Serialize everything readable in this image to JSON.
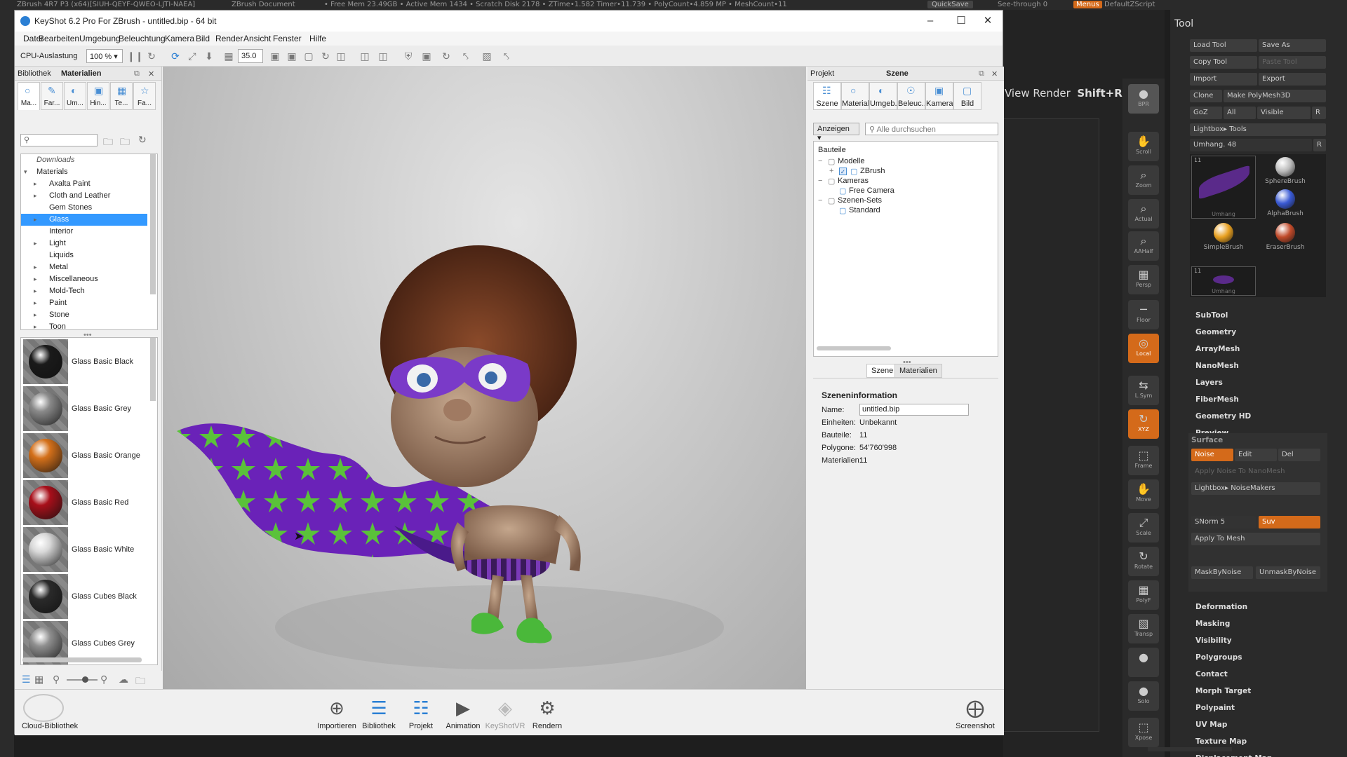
{
  "zbrush": {
    "top_left": "ZBrush 4R7 P3 (x64)[SIUH-QEYF-QWEO-LJTI-NAEA]",
    "doc": "ZBrush Document",
    "stats": "• Free Mem 23.49GB • Active Mem 1434 • Scratch Disk 2178 • ZTime•1.582 Timer•11.739 • PolyCount•4.859 MP • MeshCount•11",
    "quicksave": "QuickSave",
    "see_through": "See-through 0",
    "menus": "Menus",
    "script": "DefaultZScript",
    "view_render": "View Render",
    "view_render_shortcut": "Shift+R",
    "shelf": [
      {
        "name": "bpr",
        "label": "BPR",
        "glyph": "●",
        "or": false
      },
      {
        "name": "scroll",
        "label": "Scroll",
        "glyph": "✋",
        "or": false
      },
      {
        "name": "zoom",
        "label": "Zoom",
        "glyph": "⌕",
        "or": false
      },
      {
        "name": "actual",
        "label": "Actual",
        "glyph": "⌕",
        "or": false
      },
      {
        "name": "aahalf",
        "label": "AAHalf",
        "glyph": "⌕",
        "or": false
      },
      {
        "name": "persp",
        "label": "Persp",
        "glyph": "▦",
        "or": false
      },
      {
        "name": "floor",
        "label": "Floor",
        "glyph": "─",
        "or": false
      },
      {
        "name": "local",
        "label": "Local",
        "glyph": "◎",
        "or": true
      },
      {
        "name": "lsym",
        "label": "L.Sym",
        "glyph": "⇆",
        "or": false
      },
      {
        "name": "xyz",
        "label": "XYZ",
        "glyph": "↻",
        "or": true
      },
      {
        "name": "frame",
        "label": "Frame",
        "glyph": "⬚",
        "or": false
      },
      {
        "name": "move",
        "label": "Move",
        "glyph": "✋",
        "or": false
      },
      {
        "name": "scale",
        "label": "Scale",
        "glyph": "⤢",
        "or": false
      },
      {
        "name": "rotate",
        "label": "Rotate",
        "glyph": "↻",
        "or": false
      },
      {
        "name": "polyf",
        "label": "PolyF",
        "glyph": "▦",
        "or": false
      },
      {
        "name": "transp",
        "label": "Transp",
        "glyph": "▧",
        "or": false
      },
      {
        "name": "ghost",
        "label": "",
        "glyph": "●",
        "or": false
      },
      {
        "name": "solo",
        "label": "Solo",
        "glyph": "●",
        "or": false
      },
      {
        "name": "xpose",
        "label": "Xpose",
        "glyph": "⬚",
        "or": false
      }
    ],
    "tool": {
      "title": "Tool",
      "load_tool": "Load Tool",
      "save_as": "Save As",
      "copy_tool": "Copy Tool",
      "paste_tool": "Paste Tool",
      "import": "Import",
      "export": "Export",
      "clone": "Clone",
      "make_polymesh": "Make PolyMesh3D",
      "goz": "GoZ",
      "all": "All",
      "visible": "Visible",
      "r": "R",
      "lightbox_tools": "Lightbox▸ Tools",
      "umhang": "Umhang. 48",
      "brushes": [
        {
          "label": "Umhang",
          "color": "#5a2a8a"
        },
        {
          "label": "SphereBrush",
          "color": "#bbbbbb"
        },
        {
          "label": "AlphaBrush",
          "color": "#3a5ad4"
        },
        {
          "label": "SimpleBrush",
          "color": "#e8a020"
        },
        {
          "label": "EraserBrush",
          "color": "#c04a2a"
        },
        {
          "label": "Umhang",
          "color": "#5a2a8a"
        }
      ],
      "count_a": "11",
      "count_b": "11",
      "sections_a": [
        "SubTool",
        "Geometry",
        "ArrayMesh",
        "NanoMesh",
        "Layers",
        "FiberMesh",
        "Geometry HD",
        "Preview"
      ],
      "surface": "Surface",
      "noise": "Noise",
      "edit": "Edit",
      "del": "Del",
      "apply_noise": "Apply Noise To NanoMesh",
      "lightbox_noise": "Lightbox▸ NoiseMakers",
      "snorm": "SNorm 5",
      "suv": "Suv",
      "apply_mesh": "Apply To Mesh",
      "mask_by_noise": "MaskByNoise",
      "unmask_by_noise": "UnmaskByNoise",
      "sections_b": [
        "Deformation",
        "Masking",
        "Visibility",
        "Polygroups",
        "Contact",
        "Morph Target",
        "Polypaint",
        "UV Map",
        "Texture Map",
        "Displacement Map"
      ]
    }
  },
  "keyshot": {
    "title": "KeyShot 6.2 Pro For ZBrush - untitled.bip - 64 bit",
    "menu": [
      "Datei",
      "Bearbeiten",
      "Umgebung",
      "Beleuchtung",
      "Kamera",
      "Bild",
      "Render",
      "Ansicht",
      "Fenster",
      "Hilfe"
    ],
    "cpu_label": "CPU-Auslastung",
    "cpu_value": "100 %",
    "fov_value": "35.0",
    "library": {
      "tab_library": "Bibliothek",
      "tab_materials": "Materialien",
      "type_tabs": [
        "Ma...",
        "Far...",
        "Um...",
        "Hin...",
        "Te...",
        "Fa..."
      ],
      "search_placeholder": "",
      "tree": [
        {
          "label": "Downloads",
          "arrow": "",
          "indent": 0,
          "selected": false,
          "italic": true
        },
        {
          "label": "Materials",
          "arrow": "▾",
          "indent": 0,
          "selected": false,
          "italic": false
        },
        {
          "label": "Axalta Paint",
          "arrow": "▸",
          "indent": 1,
          "selected": false,
          "italic": false
        },
        {
          "label": "Cloth and Leather",
          "arrow": "▸",
          "indent": 1,
          "selected": false,
          "italic": false
        },
        {
          "label": "Gem Stones",
          "arrow": "",
          "indent": 1,
          "selected": false,
          "italic": false
        },
        {
          "label": "Glass",
          "arrow": "▸",
          "indent": 1,
          "selected": true,
          "italic": false
        },
        {
          "label": "Interior",
          "arrow": "",
          "indent": 1,
          "selected": false,
          "italic": false
        },
        {
          "label": "Light",
          "arrow": "▸",
          "indent": 1,
          "selected": false,
          "italic": false
        },
        {
          "label": "Liquids",
          "arrow": "",
          "indent": 1,
          "selected": false,
          "italic": false
        },
        {
          "label": "Metal",
          "arrow": "▸",
          "indent": 1,
          "selected": false,
          "italic": false
        },
        {
          "label": "Miscellaneous",
          "arrow": "▸",
          "indent": 1,
          "selected": false,
          "italic": false
        },
        {
          "label": "Mold-Tech",
          "arrow": "▸",
          "indent": 1,
          "selected": false,
          "italic": false
        },
        {
          "label": "Paint",
          "arrow": "▸",
          "indent": 1,
          "selected": false,
          "italic": false
        },
        {
          "label": "Stone",
          "arrow": "▸",
          "indent": 1,
          "selected": false,
          "italic": false
        },
        {
          "label": "Toon",
          "arrow": "▸",
          "indent": 1,
          "selected": false,
          "italic": false
        }
      ],
      "swatches": [
        {
          "label": "Glass Basic Black",
          "color": "#1a1a1a"
        },
        {
          "label": "Glass Basic Grey",
          "color": "#8a8a8a"
        },
        {
          "label": "Glass Basic Orange",
          "color": "#d4701a"
        },
        {
          "label": "Glass Basic Red",
          "color": "#a80f1a"
        },
        {
          "label": "Glass Basic White",
          "color": "#d8d8d8"
        },
        {
          "label": "Glass Cubes Black",
          "color": "#2a2a2a"
        },
        {
          "label": "Glass Cubes Grey",
          "color": "#8f8f8f"
        }
      ]
    },
    "project": {
      "tab_project": "Projekt",
      "tab_scene": "Szene",
      "tabs": [
        "Szene",
        "Material",
        "Umgeb...",
        "Beleuc...",
        "Kamera",
        "Bild"
      ],
      "show_dd": "Anzeigen",
      "search_placeholder": "Alle durchsuchen",
      "parts_header": "Bauteile",
      "tree": [
        {
          "label": "Modelle",
          "level": 0,
          "exp": "−"
        },
        {
          "label": "ZBrush",
          "level": 1,
          "exp": "+"
        },
        {
          "label": "Kameras",
          "level": 0,
          "exp": "−"
        },
        {
          "label": "Free Camera",
          "level": 1,
          "exp": ""
        },
        {
          "label": "Szenen-Sets",
          "level": 0,
          "exp": "−"
        },
        {
          "label": "Standard",
          "level": 1,
          "exp": ""
        }
      ],
      "sub_tab_scene": "Szene",
      "sub_tab_materials": "Materialien",
      "info_title": "Szeneninformation",
      "info": [
        {
          "k": "Name:",
          "v": "untitled.bip",
          "field": true
        },
        {
          "k": "Einheiten:",
          "v": "Unbekannt",
          "field": false
        },
        {
          "k": "Bauteile:",
          "v": "11",
          "field": false
        },
        {
          "k": "Polygone:",
          "v": "54'760'998",
          "field": false
        },
        {
          "k": "Materialien:",
          "v": "11",
          "field": false
        }
      ]
    },
    "bottom": {
      "cloud": "Cloud-Bibliothek",
      "buttons": [
        {
          "label": "Importieren",
          "glyph": "⊕",
          "act": false,
          "dim": false
        },
        {
          "label": "Bibliothek",
          "glyph": "☰",
          "act": true,
          "dim": false
        },
        {
          "label": "Projekt",
          "glyph": "☷",
          "act": true,
          "dim": false
        },
        {
          "label": "Animation",
          "glyph": "▶",
          "act": false,
          "dim": false
        },
        {
          "label": "KeyShotVR",
          "glyph": "◈",
          "act": false,
          "dim": true
        },
        {
          "label": "Rendern",
          "glyph": "⚙",
          "act": false,
          "dim": false
        }
      ],
      "screenshot": "Screenshot"
    }
  }
}
